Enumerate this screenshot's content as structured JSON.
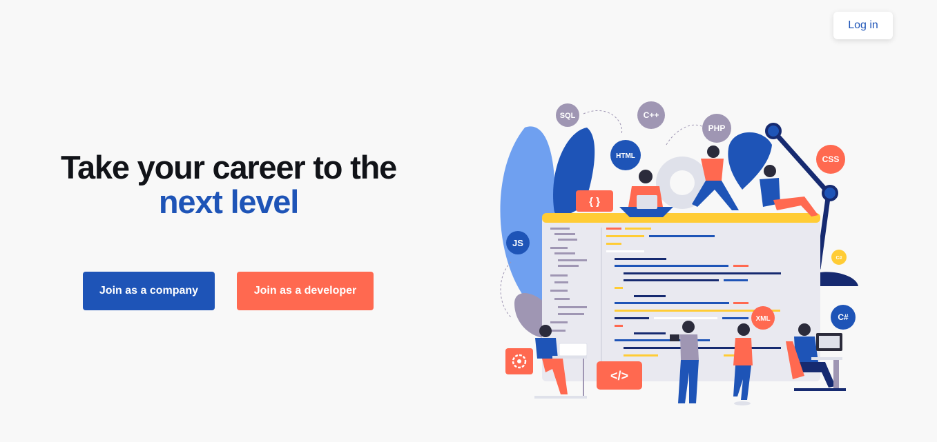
{
  "header": {
    "login_label": "Log in"
  },
  "hero": {
    "title_line1": "Take your career to the",
    "title_line2": "next level",
    "company_button": "Join as a company",
    "developer_button": "Join as a developer"
  },
  "illustration": {
    "badges": [
      "SQL",
      "C++",
      "PHP",
      "HTML",
      "CSS",
      "JS",
      "C#",
      "XML",
      "{ }",
      "</>"
    ]
  },
  "colors": {
    "brand_blue": "#1e54b7",
    "accent_orange": "#ff6950",
    "title_dark": "#111318",
    "background": "#f8f8f8"
  }
}
